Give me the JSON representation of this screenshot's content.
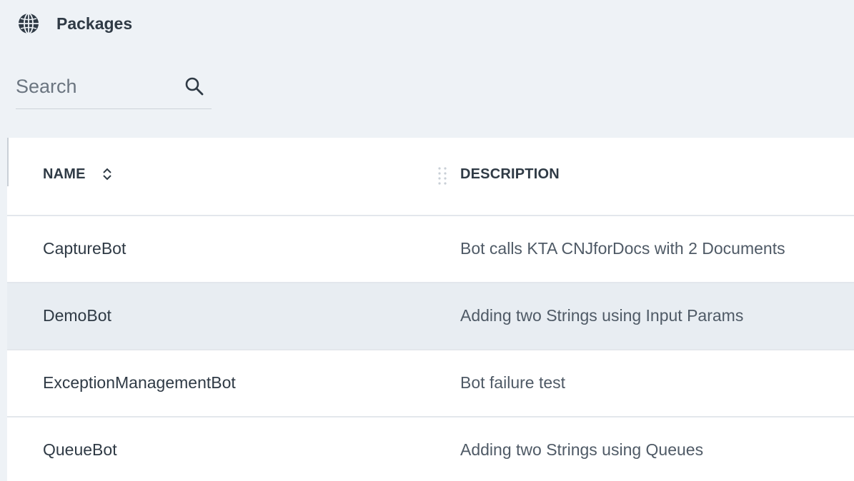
{
  "header": {
    "title": "Packages",
    "icon": "globe-icon"
  },
  "search": {
    "placeholder": "Search",
    "value": "",
    "icon": "search-icon"
  },
  "table": {
    "columns": {
      "name": "NAME",
      "description": "DESCRIPTION"
    },
    "rows": [
      {
        "name": "CaptureBot",
        "description": "Bot calls KTA CNJforDocs with 2 Documents",
        "selected": false
      },
      {
        "name": "DemoBot",
        "description": "Adding two Strings using Input Params",
        "selected": true
      },
      {
        "name": "ExceptionManagementBot",
        "description": "Bot failure test",
        "selected": false
      },
      {
        "name": "QueueBot",
        "description": "Adding two Strings using Queues",
        "selected": false
      }
    ]
  },
  "colors": {
    "background": "#eef2f6",
    "text": "#2f3a45",
    "selected_row": "#e8edf2",
    "divider": "#e3e7ec"
  }
}
